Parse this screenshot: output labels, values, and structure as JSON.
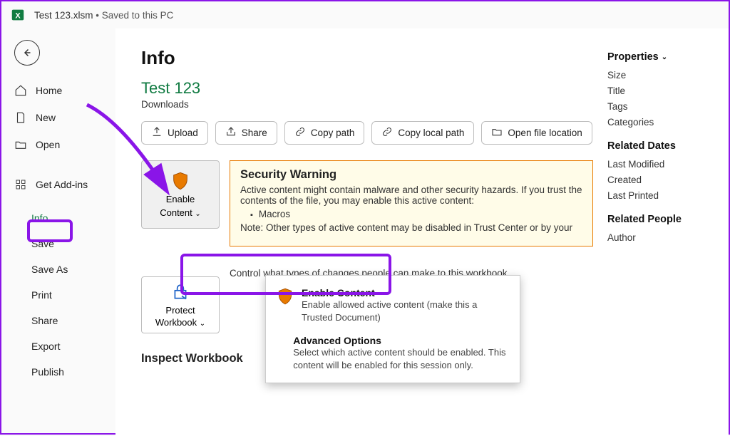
{
  "titlebar": {
    "filename": "Test 123.xlsm",
    "save_status": "• Saved to this PC"
  },
  "sidebar": {
    "items": [
      {
        "label": "Home",
        "icon": "home-icon"
      },
      {
        "label": "New",
        "icon": "new-icon"
      },
      {
        "label": "Open",
        "icon": "open-icon"
      },
      {
        "label": "Get Add-ins",
        "icon": "addins-icon"
      },
      {
        "label": "Info",
        "icon": null,
        "selected": true
      }
    ],
    "sub_items": [
      "Save",
      "Save As",
      "Print",
      "Share",
      "Export",
      "Publish"
    ]
  },
  "info": {
    "heading": "Info",
    "doc_title": "Test 123",
    "doc_location": "Downloads",
    "buttons": {
      "upload": "Upload",
      "share": "Share",
      "copy_path": "Copy path",
      "copy_local_path": "Copy local path",
      "open_location": "Open file location"
    },
    "enable_button": {
      "line1": "Enable",
      "line2": "Content"
    },
    "security": {
      "title": "Security Warning",
      "body1": "Active content might contain malware and other security hazards. If you trust the contents of the file, you may enable this active content:",
      "list_item": "Macros",
      "body2": "Note: Other types of active content may be disabled in Trust Center or by your"
    },
    "dropdown": {
      "item1": {
        "title": "Enable Content",
        "desc": "Enable allowed active content (make this a Trusted Document)"
      },
      "item2": {
        "title": "Advanced Options",
        "desc": "Select which active content should be enabled. This content will be enabled for this session only."
      }
    },
    "protect": {
      "button_line1": "Protect",
      "button_line2": "Workbook",
      "desc": "Control what types of changes people can make to this workbook."
    },
    "inspect_title": "Inspect Workbook"
  },
  "properties": {
    "header": "Properties",
    "items": [
      "Size",
      "Title",
      "Tags",
      "Categories"
    ],
    "related_dates_header": "Related Dates",
    "related_dates": [
      "Last Modified",
      "Created",
      "Last Printed"
    ],
    "related_people_header": "Related People",
    "related_people": [
      "Author"
    ]
  },
  "colors": {
    "accent_green": "#0f7a41",
    "callout_purple": "#8a15e8",
    "shield_orange": "#e87a00"
  }
}
